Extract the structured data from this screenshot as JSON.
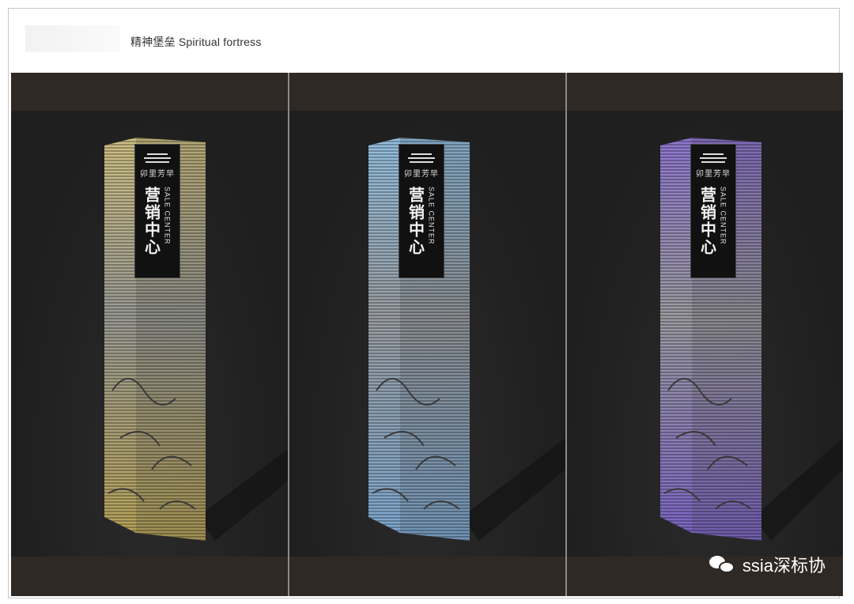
{
  "heading": {
    "cn": "精神堡垒",
    "en": "Spiritual fortress"
  },
  "sign": {
    "brand": "卯里芳早",
    "title_cn": "营销中心",
    "title_en": "SALE CENTER"
  },
  "variants": [
    {
      "name": "gold",
      "color": "#c8b97a"
    },
    {
      "name": "blue",
      "color": "#8fb5d6"
    },
    {
      "name": "purple",
      "color": "#8a72c8"
    }
  ],
  "watermark": {
    "text": "ssia深标协",
    "icon": "wechat-icon"
  }
}
